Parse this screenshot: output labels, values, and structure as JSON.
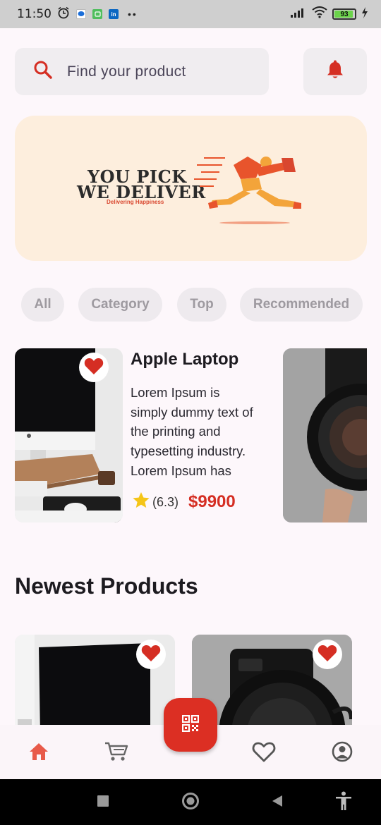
{
  "status_bar": {
    "time": "11:50",
    "battery_level": 93,
    "battery_label": "93",
    "dots": "••",
    "icons": [
      "alarm-icon",
      "messages-app-icon",
      "chat-app-icon",
      "linkedin-app-icon",
      "signal-icon",
      "wifi-icon",
      "battery-icon",
      "charging-icon"
    ]
  },
  "search": {
    "placeholder": "Find your product"
  },
  "banner": {
    "line1": "YOU PICK",
    "line2": "WE DELIVER",
    "tagline": "Delivering Happiness"
  },
  "chips": [
    {
      "label": "All"
    },
    {
      "label": "Category"
    },
    {
      "label": "Top"
    },
    {
      "label": "Recommended"
    }
  ],
  "featured": {
    "title": "Apple Laptop",
    "description": "Lorem Ipsum is simply dummy text of the printing and typesetting industry. Lorem Ipsum has been the industry's standard dummy text.",
    "rating": "(6.3)",
    "price": "$9900"
  },
  "newest": {
    "title": "Newest Products"
  },
  "colors": {
    "accent": "#dc2f23",
    "background": "#fdf7fb",
    "surface": "#f0edf0",
    "banner_bg": "#fdeedd",
    "star": "#f5c518"
  },
  "bottom_nav": {
    "items": [
      "home-icon",
      "cart-icon",
      "qr-code-icon",
      "heart-icon",
      "profile-icon"
    ],
    "active": "home"
  }
}
